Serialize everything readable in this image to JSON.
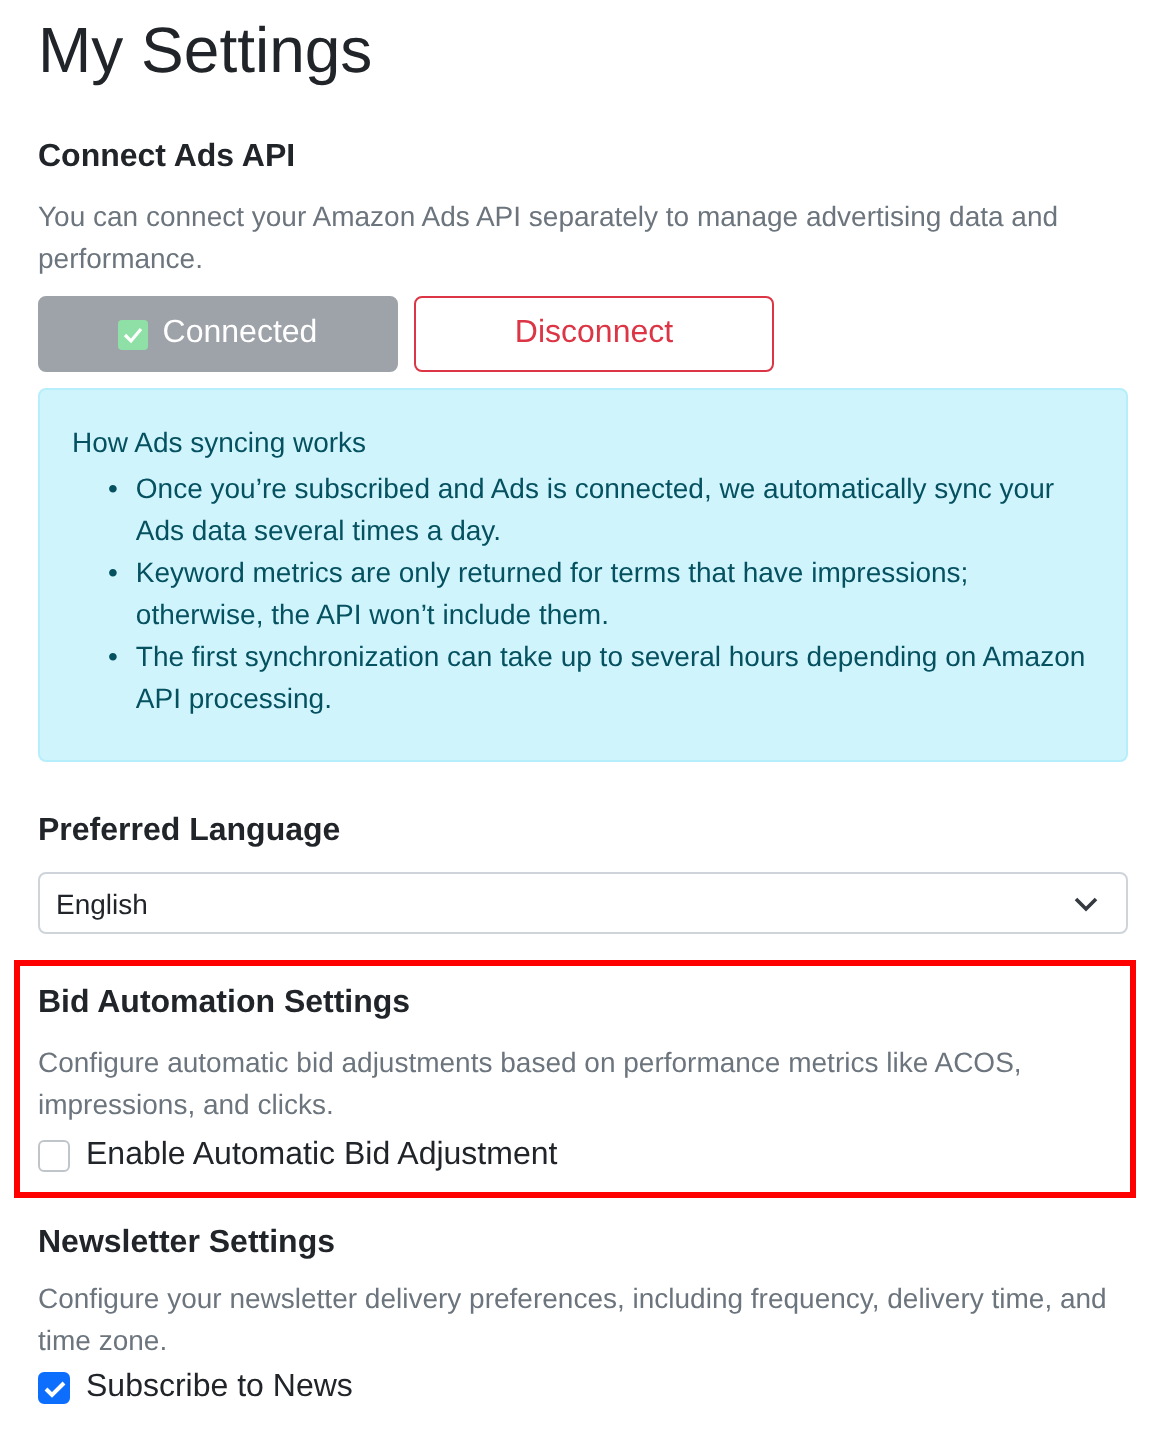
{
  "page": {
    "title": "My Settings"
  },
  "ads_api": {
    "heading": "Connect Ads API",
    "description": "You can connect your Amazon Ads API separately to manage advertising data and performance.",
    "connected_button": {
      "label": "Connected",
      "connected": true
    },
    "disconnect_button": {
      "label": "Disconnect"
    },
    "info": {
      "title": "How Ads syncing works",
      "bullet": "•",
      "items": [
        "Once you’re subscribed and Ads is connected, we automatically sync your Ads data several times a day.",
        "Keyword metrics are only returned for terms that have impressions; otherwise, the API won’t include them.",
        "The first synchronization can take up to several hours depending on Amazon API processing."
      ]
    }
  },
  "language": {
    "heading": "Preferred Language",
    "select": {
      "value": "English"
    }
  },
  "bid_automation": {
    "highlighted": true,
    "heading": "Bid Automation Settings",
    "description": "Configure automatic bid adjustments based on performance metrics like ACOS, impressions, and clicks.",
    "checkbox": {
      "label": "Enable Automatic Bid Adjustment",
      "checked": false
    }
  },
  "newsletter": {
    "heading": "Newsletter Settings",
    "description": "Configure your newsletter delivery preferences, including frequency, delivery time, and time zone.",
    "checkbox": {
      "label": "Subscribe to News",
      "checked": true
    }
  }
}
